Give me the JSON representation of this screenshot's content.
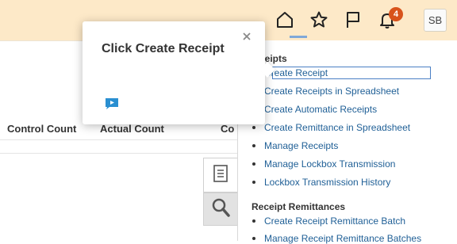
{
  "topbar": {
    "notification_count": "4",
    "avatar_initials": "SB",
    "icons": [
      "home-icon",
      "favorites-star-icon",
      "flag-icon",
      "bell-icon"
    ]
  },
  "table": {
    "headers": [
      "Control Count",
      "Actual Count",
      "Co"
    ]
  },
  "tasks_panel": {
    "section1_title": "ceipts",
    "section1_items": [
      "Create Receipt",
      "Create Receipts in Spreadsheet",
      "Create Automatic Receipts",
      "Create Remittance in Spreadsheet",
      "Manage Receipts",
      "Manage Lockbox Transmission",
      "Lockbox Transmission History"
    ],
    "section2_title": "Receipt Remittances",
    "section2_items": [
      "Create Receipt Remittance Batch",
      "Manage Receipt Remittance Batches"
    ]
  },
  "side_tabs": [
    "tasks-icon",
    "search-icon"
  ],
  "guide_popup": {
    "title": "Click Create Receipt"
  },
  "colors": {
    "topbar_bg": "#fde9c8",
    "badge": "#d8531c",
    "link": "#1f5f96",
    "chat_icon": "#2a8fd1"
  }
}
